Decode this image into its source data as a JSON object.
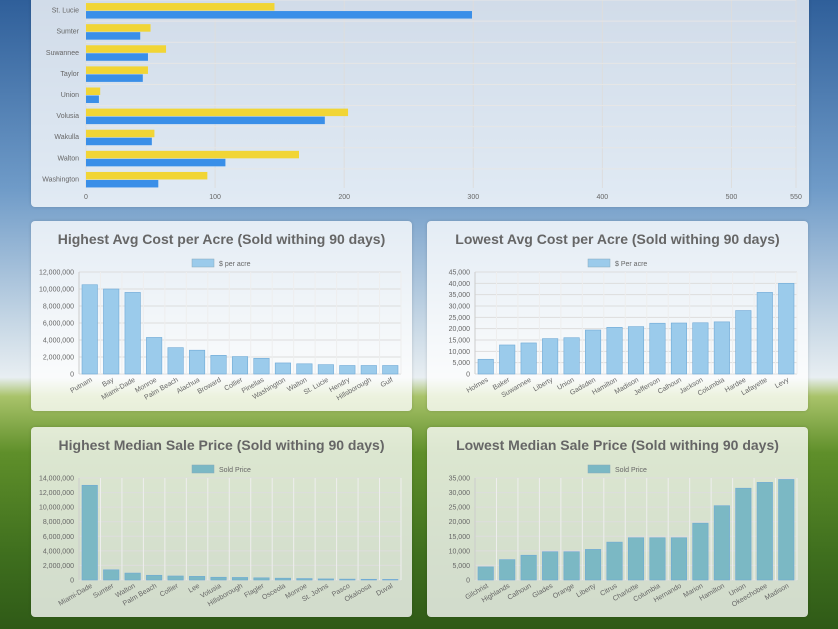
{
  "panels": [
    {
      "title": "",
      "chart_data": {
        "type": "bar",
        "orientation": "horizontal",
        "categories": [
          "St. Lucie",
          "Sumter",
          "Suwannee",
          "Taylor",
          "Union",
          "Volusia",
          "Wakulla",
          "Walton",
          "Washington"
        ],
        "series": [
          {
            "color": "#f1d535",
            "values": [
              146,
              50,
              62,
              48,
              11,
              203,
              53,
              165,
              94
            ]
          },
          {
            "color": "#3a8fe8",
            "values": [
              299,
              42,
              48,
              44,
              10,
              185,
              51,
              108,
              56
            ]
          }
        ],
        "xlim": [
          0,
          550
        ],
        "xticks": [
          "0",
          "100",
          "200",
          "300",
          "400",
          "500",
          "550"
        ],
        "xtick_values": [
          0,
          100,
          200,
          300,
          400,
          500,
          550
        ],
        "grid": true
      }
    },
    {
      "title": "Highest Avg Cost per Acre (Sold withing 90 days)",
      "chart_data": {
        "type": "bar",
        "categories": [
          "Putnam",
          "Bay",
          "Miami-Dade",
          "Monroe",
          "Palm Beach",
          "Alachua",
          "Broward",
          "Collier",
          "Pinellas",
          "Washington",
          "Walton",
          "St. Lucie",
          "Hendry",
          "Hillsborough",
          "Gulf"
        ],
        "series": [
          {
            "name": "$ per acre",
            "color": "#9bcbeb",
            "values": [
              10500000,
              10000000,
              9600000,
              4300000,
              3100000,
              2800000,
              2200000,
              2050000,
              1850000,
              1300000,
              1200000,
              1100000,
              1000000,
              1000000,
              1000000
            ]
          }
        ],
        "ylim": [
          0,
          12000000
        ],
        "yticks": [
          "0",
          "2,000,000",
          "4,000,000",
          "6,000,000",
          "8,000,000",
          "10,000,000",
          "12,000,000"
        ],
        "ytick_values": [
          0,
          2000000,
          4000000,
          6000000,
          8000000,
          10000000,
          12000000
        ],
        "legend": "top-center",
        "grid": true
      }
    },
    {
      "title": "Lowest Avg Cost per Acre (Sold withing 90 days)",
      "chart_data": {
        "type": "bar",
        "categories": [
          "Holmes",
          "Baker",
          "Suwannee",
          "Liberty",
          "Union",
          "Gadsden",
          "Hamilton",
          "Madison",
          "Jefferson",
          "Calhoun",
          "Jackson",
          "Columbia",
          "Hardee",
          "Lafayette",
          "Levy"
        ],
        "series": [
          {
            "name": "$ Per acre",
            "color": "#9bcbeb",
            "values": [
              6500,
              12800,
              13700,
              15600,
              16000,
              19400,
              20600,
              20900,
              22400,
              22500,
              22600,
              23000,
              28000,
              36000,
              40000
            ]
          }
        ],
        "ylim": [
          0,
          45000
        ],
        "yticks": [
          "0",
          "5,000",
          "10,000",
          "15,000",
          "20,000",
          "25,000",
          "30,000",
          "35,000",
          "40,000",
          "45,000"
        ],
        "ytick_values": [
          0,
          5000,
          10000,
          15000,
          20000,
          25000,
          30000,
          35000,
          40000,
          45000
        ],
        "legend": "top-center",
        "grid": true
      }
    },
    {
      "title": "Highest Median Sale Price (Sold withing 90 days)",
      "chart_data": {
        "type": "bar",
        "categories": [
          "Miami-Dade",
          "Sumter",
          "Walton",
          "Palm Beach",
          "Collier",
          "Lee",
          "Volusia",
          "Hillsborough",
          "Flagler",
          "Osceola",
          "Monroe",
          "St. Johns",
          "Pasco",
          "Okaloosa",
          "Duval"
        ],
        "series": [
          {
            "name": "Sold Price",
            "color": "#7bb8c4",
            "values": [
              13000000,
              1400000,
              950000,
              650000,
              550000,
              500000,
              380000,
              350000,
              300000,
              250000,
              200000,
              150000,
              120000,
              100000,
              80000
            ]
          }
        ],
        "ylim": [
          0,
          14000000
        ],
        "yticks": [
          "0",
          "2,000,000",
          "4,000,000",
          "6,000,000",
          "8,000,000",
          "10,000,000",
          "12,000,000",
          "14,000,000"
        ],
        "ytick_values": [
          0,
          2000000,
          4000000,
          6000000,
          8000000,
          10000000,
          12000000,
          14000000
        ],
        "legend": "top-center",
        "grid": true
      }
    },
    {
      "title": "Lowest Median Sale Price (Sold withing 90 days)",
      "chart_data": {
        "type": "bar",
        "categories": [
          "Gilchrist",
          "Highlands",
          "Calhoun",
          "Glades",
          "Orange",
          "Liberty",
          "Citrus",
          "Charlotte",
          "Columbia",
          "Hernando",
          "Marion",
          "Hamilton",
          "Union",
          "Okeechobee",
          "Madison"
        ],
        "series": [
          {
            "name": "Sold Price",
            "color": "#7bb8c4",
            "values": [
              4500,
              7000,
              8500,
              9700,
              9700,
              10500,
              13000,
              14500,
              14500,
              14500,
              19500,
              25500,
              31500,
              33500,
              34500
            ]
          }
        ],
        "ylim": [
          0,
          35000
        ],
        "yticks": [
          "0",
          "5,000",
          "10,000",
          "15,000",
          "20,000",
          "25,000",
          "30,000",
          "35,000"
        ],
        "ytick_values": [
          0,
          5000,
          10000,
          15000,
          20000,
          25000,
          30000,
          35000
        ],
        "legend": "top-center",
        "grid": true
      }
    }
  ]
}
